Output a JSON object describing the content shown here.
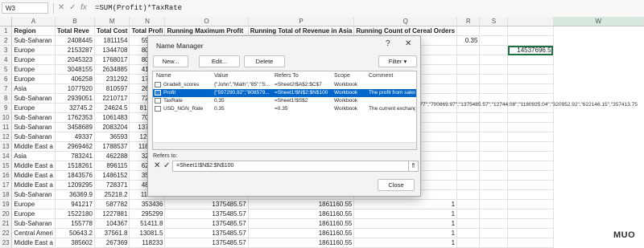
{
  "formula_bar": {
    "name_box": "W3",
    "formula": "=SUM(Profit)*TaxRate",
    "cancel_icon": "✕",
    "enter_icon": "✓",
    "fx_icon": "fx"
  },
  "sheet": {
    "columns": [
      "A",
      "B",
      "M",
      "N",
      "O",
      "P",
      "Q",
      "R",
      "S",
      "W"
    ],
    "row_numbers": [
      "1",
      "2",
      "3",
      "4",
      "5",
      "6",
      "7",
      "8",
      "9",
      "10",
      "11",
      "12",
      "13",
      "14",
      "15",
      "16",
      "17",
      "18",
      "19",
      "20",
      "21",
      "22",
      "23",
      "24",
      "25",
      "26"
    ],
    "header_row": [
      "Region",
      "Total Reve",
      "Total Cost",
      "Total Profi",
      "Running Maximum Profit",
      "Running Total of Revenue in Asia",
      "Running Count of Cereal Orders",
      "",
      ""
    ],
    "col_a": [
      "Sub-Saharan",
      "Europe",
      "Europe",
      "Europe",
      "Europe",
      "Asia",
      "Sub-Saharan",
      "Europe",
      "Sub-Saharan",
      "Sub-Saharan",
      "Sub-Saharan",
      "Middle East a",
      "Asia",
      "Middle East a",
      "Middle East a",
      "Middle East a",
      "Sub-Saharan",
      "Europe",
      "Europe",
      "Sub-Saharan",
      "Central Ameri",
      "Middle East a"
    ],
    "col_b": [
      "2408445",
      "2153287",
      "2045323",
      "3048155",
      "406258",
      "1077920",
      "2939051",
      "32745.2",
      "1762353",
      "3458689",
      "49337",
      "2969462",
      "783241",
      "1518261",
      "1843576",
      "1209295",
      "36369.9",
      "941217",
      "1522180",
      "155778",
      "50643.2",
      "385602"
    ],
    "col_m": [
      "1811154",
      "1344708",
      "1768017",
      "2634885",
      "231292",
      "810597",
      "2210717",
      "24624.5",
      "1061483",
      "2083204",
      "36593",
      "1788537",
      "462288",
      "896115",
      "1486152",
      "728371",
      "25218.2",
      "587782",
      "1227881",
      "104367",
      "37561.8",
      "267369"
    ],
    "col_n": [
      "597291",
      "808579",
      "808579",
      "413270",
      "174965",
      "267322",
      "728881",
      "8120.77",
      "700870",
      "1375486",
      "12744.1",
      "1180925",
      "320953",
      "622146",
      "357414",
      "480924",
      "11151.7",
      "353436",
      "295299",
      "51411.8",
      "13081.5",
      "118233"
    ],
    "col_o": [
      "",
      "",
      "",
      "",
      "",
      "",
      "",
      "",
      "",
      "",
      "",
      "",
      "",
      "",
      "",
      "",
      "",
      "1375485.57",
      "1375485.57",
      "1375485.57",
      "1375485.57",
      "1375485.57"
    ],
    "col_p": [
      "",
      "",
      "",
      "",
      "",
      "",
      "",
      "",
      "",
      "",
      "",
      "",
      "",
      "",
      "",
      "",
      "",
      "1861160.55",
      "1861160.55",
      "1861160.55",
      "1861160.55",
      "1861160.55"
    ],
    "col_q": [
      "",
      "",
      "",
      "",
      "",
      "",
      "",
      "",
      "",
      "",
      "",
      "",
      "",
      "",
      "",
      "",
      "",
      "1",
      "1",
      "1",
      "1",
      "1"
    ],
    "s2_value": "0.35",
    "w3_value": "14537696.5",
    "spill_row8": "0.77\",\"700869.97\",\"1375485.57\",\"12744.08\",\"1180925.04\",\"320952.92\",\"622146.15\",\"357413.75"
  },
  "dialog": {
    "title": "Name Manager",
    "help_icon": "?",
    "close_icon": "✕",
    "buttons": {
      "new": "New...",
      "edit": "Edit...",
      "delete": "Delete",
      "filter": "Filter ▾",
      "close": "Close"
    },
    "list_headers": [
      "Name",
      "Value",
      "Refers To",
      "Scope",
      "Comment"
    ],
    "names": [
      {
        "name": "Grade8_scores",
        "value": "{\"John\",\"Math\",\"85\";\"S...",
        "refers_to": "=Sheet2!$A$2:$C$7",
        "scope": "Workbook",
        "comment": "",
        "selected": false
      },
      {
        "name": "Profit",
        "value": "{\"597290.92\";\"808579...",
        "refers_to": "=Sheet1!$N$2:$N$100",
        "scope": "Workbook",
        "comment": "The profit from sales.",
        "selected": true
      },
      {
        "name": "TaxRate",
        "value": "0.35",
        "refers_to": "=Sheet1!$S$2",
        "scope": "Workbook",
        "comment": "",
        "selected": false
      },
      {
        "name": "USD_NGN_Rate",
        "value": "0.35",
        "refers_to": "=0.35",
        "scope": "Workbook",
        "comment": "The current exchange...",
        "selected": false
      }
    ],
    "refers_to_label": "Refers to:",
    "refers_to_value": "=Sheet1!$N$2:$N$100",
    "ref_cancel_icon": "✕",
    "ref_ok_icon": "✓",
    "ref_collapse_icon": "⇑"
  },
  "watermark": "MUO",
  "colors": {
    "accent": "#1e7145",
    "selection": "#0066cc"
  }
}
